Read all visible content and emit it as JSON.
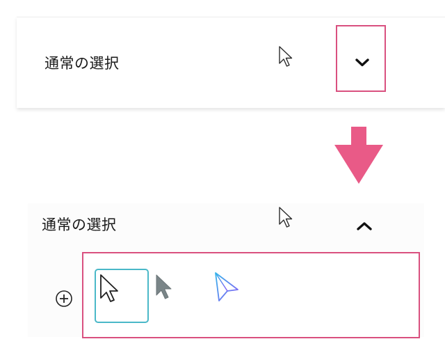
{
  "selection_label": "通常の選択",
  "icons": {
    "cursor_hint": "pointer-cursor-icon",
    "collapsed_toggle": "chevron-down-icon",
    "expanded_toggle": "chevron-up-icon",
    "transition": "arrow-down-icon",
    "add": "plus-circle-icon",
    "option_default": "pointer-cursor-icon",
    "option_gray": "gray-pointer-icon",
    "option_paper": "paper-plane-icon"
  },
  "colors": {
    "highlight_border": "#d9507f",
    "transition_arrow": "#e95a87",
    "selected_option_border": "#4ab8c8",
    "gray_pointer": "#7a8588",
    "paper_plane_start": "#34b5ea",
    "paper_plane_end": "#8b5cf6"
  },
  "collapsed_panel": {
    "label": "通常の選択"
  },
  "expanded_panel": {
    "label": "通常の選択",
    "selected_option": "option_default"
  }
}
